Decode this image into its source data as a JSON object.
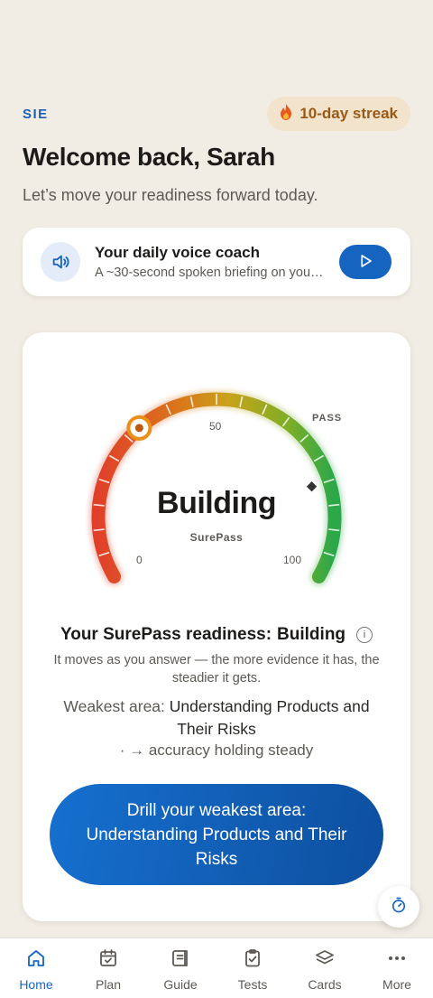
{
  "header": {
    "brand": "SIE",
    "streak_icon": "flame-icon",
    "streak_label": "10-day streak",
    "welcome": "Welcome back, Sarah",
    "subtitle": "Let’s move your readiness forward today."
  },
  "coach": {
    "icon": "speaker-icon",
    "title": "Your daily voice coach",
    "description": "A ~30-second spoken briefing on your progress",
    "play_icon": "play-icon"
  },
  "gauge": {
    "state": "Building",
    "brand": "SurePass",
    "min_label": "0",
    "mid_label": "50",
    "max_label": "100",
    "pass_label": "PASS",
    "value": 33,
    "pass_value": 80,
    "colors": {
      "low": "#e0402a",
      "mid": "#d99a16",
      "high": "#2aa84a"
    }
  },
  "readiness": {
    "label": "Your SurePass readiness:",
    "value": "Building",
    "info_icon": "info-icon",
    "explanation": "It moves as you answer — the more evidence it has, the steadier it gets.",
    "weakest_prefix": "Weakest area:",
    "weakest_area": "Understanding Products and Their Risks",
    "trend": "· → accuracy holding steady",
    "drill_button": "Drill your weakest area: Understanding Products and Their Risks"
  },
  "fab": {
    "icon": "stopwatch-icon"
  },
  "tabs": [
    {
      "label": "Home",
      "icon": "home-icon",
      "active": true
    },
    {
      "label": "Plan",
      "icon": "calendar-icon",
      "active": false
    },
    {
      "label": "Guide",
      "icon": "book-icon",
      "active": false
    },
    {
      "label": "Tests",
      "icon": "clipboard-icon",
      "active": false
    },
    {
      "label": "Cards",
      "icon": "layers-icon",
      "active": false
    },
    {
      "label": "More",
      "icon": "more-icon",
      "active": false
    }
  ]
}
